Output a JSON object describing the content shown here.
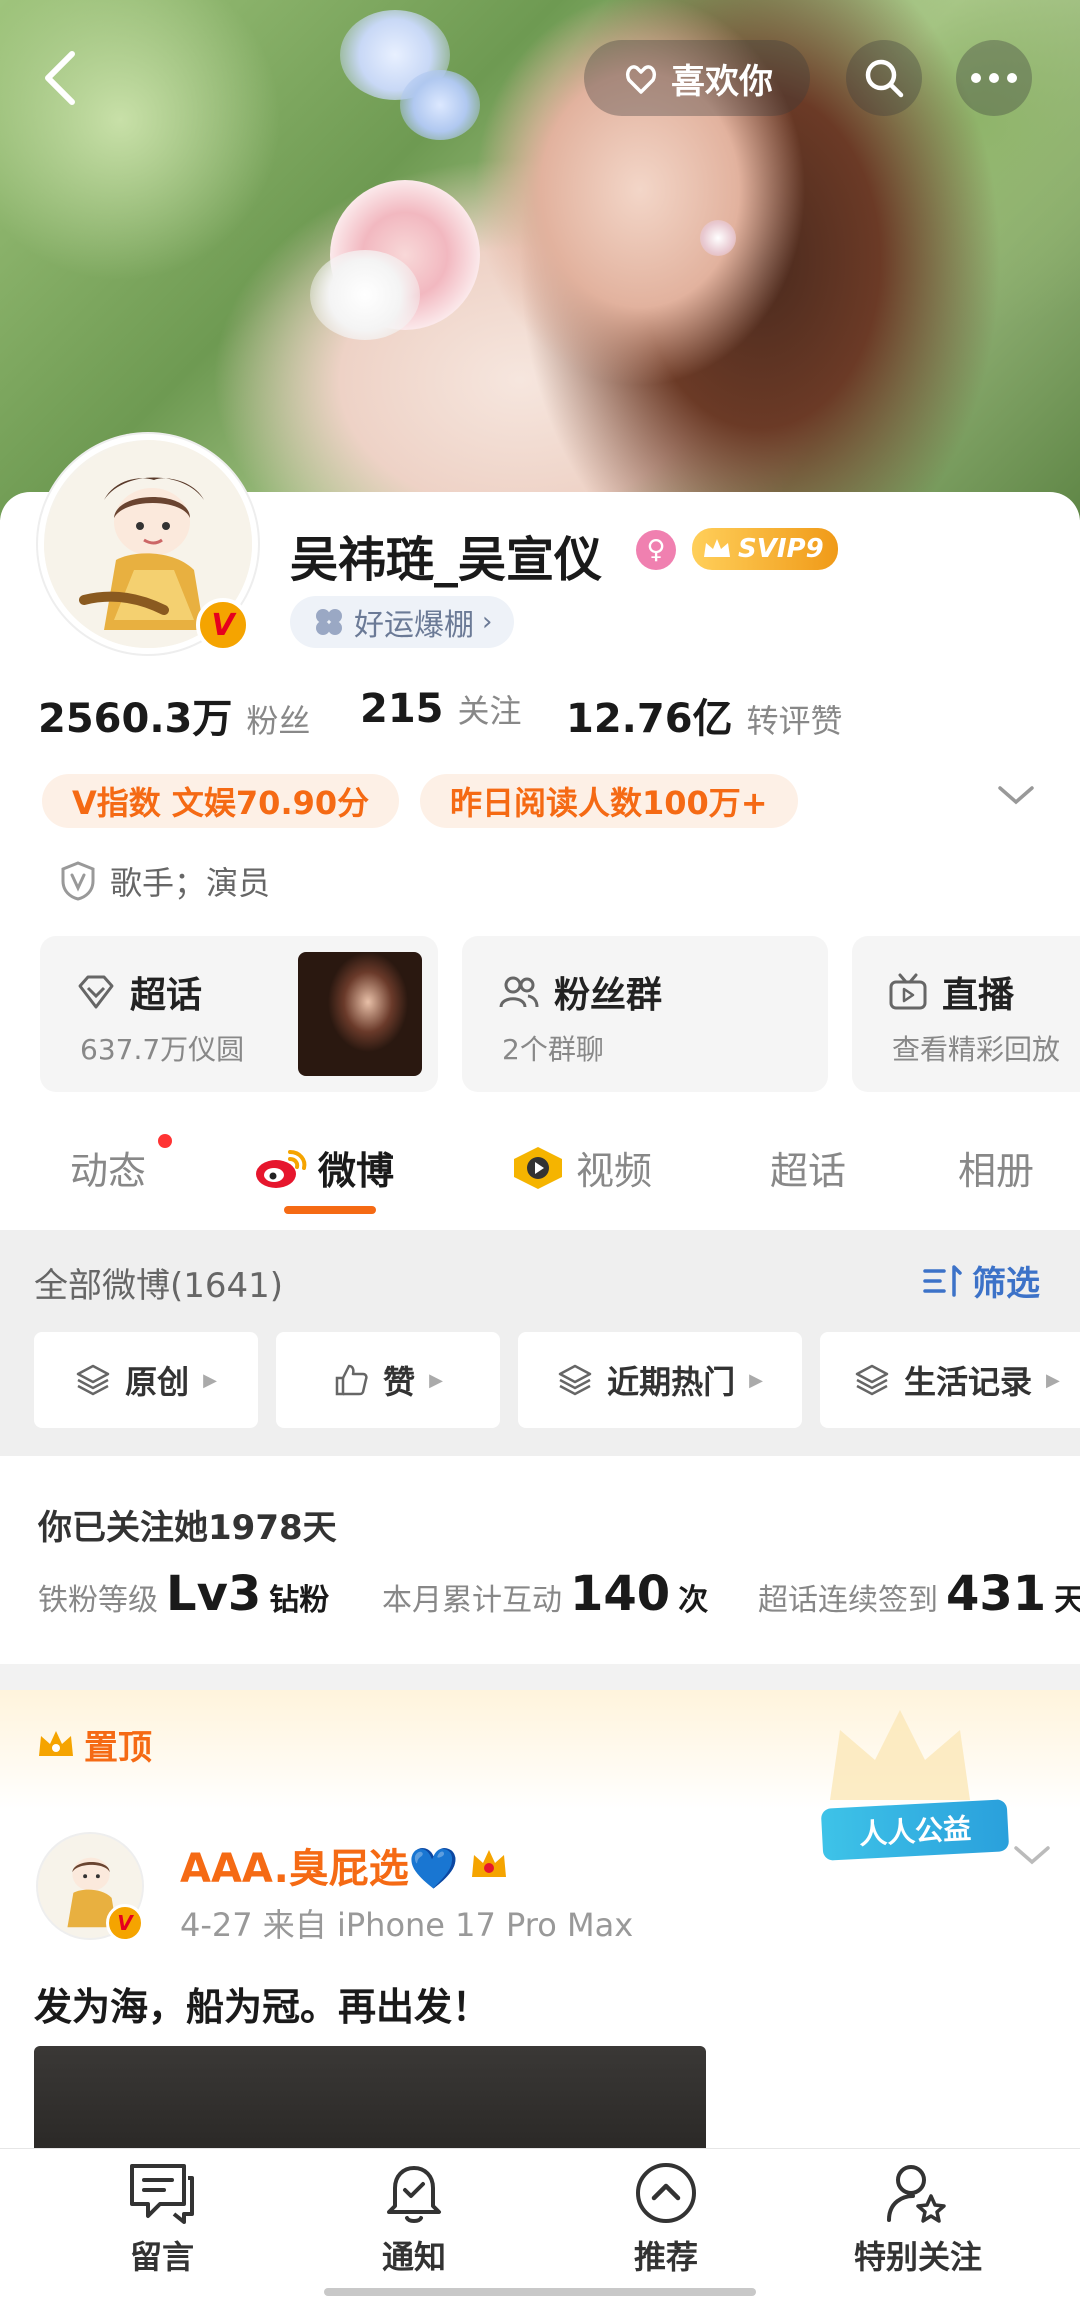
{
  "header": {
    "like_label": "喜欢你"
  },
  "profile": {
    "nickname": "吴祎琏_吴宣仪",
    "gender_symbol": "♀",
    "vip_label": "SVIP9",
    "verified_badge": "V",
    "luck_label": "好运爆棚",
    "stats": [
      {
        "value": "2560.3万",
        "label": "粉丝"
      },
      {
        "value": "215",
        "label": "关注"
      },
      {
        "value": "12.76亿",
        "label": "转评赞"
      }
    ],
    "chips": [
      "V指数 文娱70.90分",
      "昨日阅读人数100万+"
    ],
    "verification": "歌手；演员",
    "cards": [
      {
        "title": "超话",
        "subtitle": "637.7万仪圆",
        "icon": "diamond-icon"
      },
      {
        "title": "粉丝群",
        "subtitle": "2个群聊",
        "icon": "group-icon"
      },
      {
        "title": "直播",
        "subtitle": "查看精彩回放",
        "icon": "tv-icon"
      }
    ]
  },
  "tabs": [
    {
      "label": "动态",
      "active": false,
      "dot": true
    },
    {
      "label": "微博",
      "active": true
    },
    {
      "label": "视频",
      "active": false
    },
    {
      "label": "超话",
      "active": false
    },
    {
      "label": "相册",
      "active": false
    }
  ],
  "feed": {
    "all_label": "全部微博(1641)",
    "filter_label": "筛选",
    "filters": [
      "原创",
      "赞",
      "近期热门",
      "生活记录"
    ]
  },
  "follow": {
    "days_text": "你已关注她1978天",
    "level_label": "铁粉等级",
    "level_value": "Lv3",
    "level_unit": "钻粉",
    "interact_label": "本月累计互动",
    "interact_value": "140",
    "interact_unit": "次",
    "checkin_label": "超话连续签到",
    "checkin_value": "431",
    "checkin_unit": "天"
  },
  "pinned": {
    "label": "置顶",
    "campaign": "人人公益",
    "author": "AAA.臭屁选💙",
    "meta": "4-27  来自 iPhone 17 Pro Max",
    "text": "发为海，船为冠。再出发！"
  },
  "bottom_nav": [
    {
      "label": "留言",
      "icon": "message-icon"
    },
    {
      "label": "通知",
      "icon": "bell-icon"
    },
    {
      "label": "推荐",
      "icon": "recommend-icon"
    },
    {
      "label": "特别关注",
      "icon": "special-follow-icon"
    }
  ],
  "colors": {
    "accent": "#f56a14",
    "link": "#3c72c8",
    "gold": "#f5a400"
  }
}
